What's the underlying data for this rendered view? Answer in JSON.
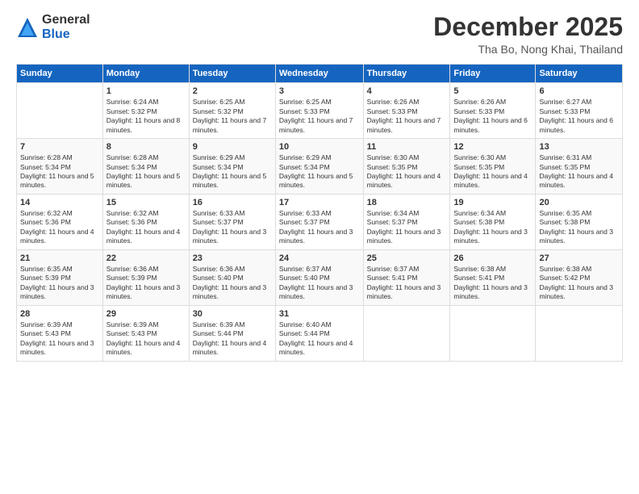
{
  "header": {
    "logo": {
      "line1": "General",
      "line2": "Blue"
    },
    "title": "December 2025",
    "location": "Tha Bo, Nong Khai, Thailand"
  },
  "calendar": {
    "days_of_week": [
      "Sunday",
      "Monday",
      "Tuesday",
      "Wednesday",
      "Thursday",
      "Friday",
      "Saturday"
    ],
    "weeks": [
      [
        {
          "date": "",
          "sunrise": "",
          "sunset": "",
          "daylight": ""
        },
        {
          "date": "1",
          "sunrise": "Sunrise: 6:24 AM",
          "sunset": "Sunset: 5:32 PM",
          "daylight": "Daylight: 11 hours and 8 minutes."
        },
        {
          "date": "2",
          "sunrise": "Sunrise: 6:25 AM",
          "sunset": "Sunset: 5:32 PM",
          "daylight": "Daylight: 11 hours and 7 minutes."
        },
        {
          "date": "3",
          "sunrise": "Sunrise: 6:25 AM",
          "sunset": "Sunset: 5:33 PM",
          "daylight": "Daylight: 11 hours and 7 minutes."
        },
        {
          "date": "4",
          "sunrise": "Sunrise: 6:26 AM",
          "sunset": "Sunset: 5:33 PM",
          "daylight": "Daylight: 11 hours and 7 minutes."
        },
        {
          "date": "5",
          "sunrise": "Sunrise: 6:26 AM",
          "sunset": "Sunset: 5:33 PM",
          "daylight": "Daylight: 11 hours and 6 minutes."
        },
        {
          "date": "6",
          "sunrise": "Sunrise: 6:27 AM",
          "sunset": "Sunset: 5:33 PM",
          "daylight": "Daylight: 11 hours and 6 minutes."
        }
      ],
      [
        {
          "date": "7",
          "sunrise": "Sunrise: 6:28 AM",
          "sunset": "Sunset: 5:34 PM",
          "daylight": "Daylight: 11 hours and 5 minutes."
        },
        {
          "date": "8",
          "sunrise": "Sunrise: 6:28 AM",
          "sunset": "Sunset: 5:34 PM",
          "daylight": "Daylight: 11 hours and 5 minutes."
        },
        {
          "date": "9",
          "sunrise": "Sunrise: 6:29 AM",
          "sunset": "Sunset: 5:34 PM",
          "daylight": "Daylight: 11 hours and 5 minutes."
        },
        {
          "date": "10",
          "sunrise": "Sunrise: 6:29 AM",
          "sunset": "Sunset: 5:34 PM",
          "daylight": "Daylight: 11 hours and 5 minutes."
        },
        {
          "date": "11",
          "sunrise": "Sunrise: 6:30 AM",
          "sunset": "Sunset: 5:35 PM",
          "daylight": "Daylight: 11 hours and 4 minutes."
        },
        {
          "date": "12",
          "sunrise": "Sunrise: 6:30 AM",
          "sunset": "Sunset: 5:35 PM",
          "daylight": "Daylight: 11 hours and 4 minutes."
        },
        {
          "date": "13",
          "sunrise": "Sunrise: 6:31 AM",
          "sunset": "Sunset: 5:35 PM",
          "daylight": "Daylight: 11 hours and 4 minutes."
        }
      ],
      [
        {
          "date": "14",
          "sunrise": "Sunrise: 6:32 AM",
          "sunset": "Sunset: 5:36 PM",
          "daylight": "Daylight: 11 hours and 4 minutes."
        },
        {
          "date": "15",
          "sunrise": "Sunrise: 6:32 AM",
          "sunset": "Sunset: 5:36 PM",
          "daylight": "Daylight: 11 hours and 4 minutes."
        },
        {
          "date": "16",
          "sunrise": "Sunrise: 6:33 AM",
          "sunset": "Sunset: 5:37 PM",
          "daylight": "Daylight: 11 hours and 3 minutes."
        },
        {
          "date": "17",
          "sunrise": "Sunrise: 6:33 AM",
          "sunset": "Sunset: 5:37 PM",
          "daylight": "Daylight: 11 hours and 3 minutes."
        },
        {
          "date": "18",
          "sunrise": "Sunrise: 6:34 AM",
          "sunset": "Sunset: 5:37 PM",
          "daylight": "Daylight: 11 hours and 3 minutes."
        },
        {
          "date": "19",
          "sunrise": "Sunrise: 6:34 AM",
          "sunset": "Sunset: 5:38 PM",
          "daylight": "Daylight: 11 hours and 3 minutes."
        },
        {
          "date": "20",
          "sunrise": "Sunrise: 6:35 AM",
          "sunset": "Sunset: 5:38 PM",
          "daylight": "Daylight: 11 hours and 3 minutes."
        }
      ],
      [
        {
          "date": "21",
          "sunrise": "Sunrise: 6:35 AM",
          "sunset": "Sunset: 5:39 PM",
          "daylight": "Daylight: 11 hours and 3 minutes."
        },
        {
          "date": "22",
          "sunrise": "Sunrise: 6:36 AM",
          "sunset": "Sunset: 5:39 PM",
          "daylight": "Daylight: 11 hours and 3 minutes."
        },
        {
          "date": "23",
          "sunrise": "Sunrise: 6:36 AM",
          "sunset": "Sunset: 5:40 PM",
          "daylight": "Daylight: 11 hours and 3 minutes."
        },
        {
          "date": "24",
          "sunrise": "Sunrise: 6:37 AM",
          "sunset": "Sunset: 5:40 PM",
          "daylight": "Daylight: 11 hours and 3 minutes."
        },
        {
          "date": "25",
          "sunrise": "Sunrise: 6:37 AM",
          "sunset": "Sunset: 5:41 PM",
          "daylight": "Daylight: 11 hours and 3 minutes."
        },
        {
          "date": "26",
          "sunrise": "Sunrise: 6:38 AM",
          "sunset": "Sunset: 5:41 PM",
          "daylight": "Daylight: 11 hours and 3 minutes."
        },
        {
          "date": "27",
          "sunrise": "Sunrise: 6:38 AM",
          "sunset": "Sunset: 5:42 PM",
          "daylight": "Daylight: 11 hours and 3 minutes."
        }
      ],
      [
        {
          "date": "28",
          "sunrise": "Sunrise: 6:39 AM",
          "sunset": "Sunset: 5:43 PM",
          "daylight": "Daylight: 11 hours and 3 minutes."
        },
        {
          "date": "29",
          "sunrise": "Sunrise: 6:39 AM",
          "sunset": "Sunset: 5:43 PM",
          "daylight": "Daylight: 11 hours and 4 minutes."
        },
        {
          "date": "30",
          "sunrise": "Sunrise: 6:39 AM",
          "sunset": "Sunset: 5:44 PM",
          "daylight": "Daylight: 11 hours and 4 minutes."
        },
        {
          "date": "31",
          "sunrise": "Sunrise: 6:40 AM",
          "sunset": "Sunset: 5:44 PM",
          "daylight": "Daylight: 11 hours and 4 minutes."
        },
        {
          "date": "",
          "sunrise": "",
          "sunset": "",
          "daylight": ""
        },
        {
          "date": "",
          "sunrise": "",
          "sunset": "",
          "daylight": ""
        },
        {
          "date": "",
          "sunrise": "",
          "sunset": "",
          "daylight": ""
        }
      ]
    ]
  }
}
